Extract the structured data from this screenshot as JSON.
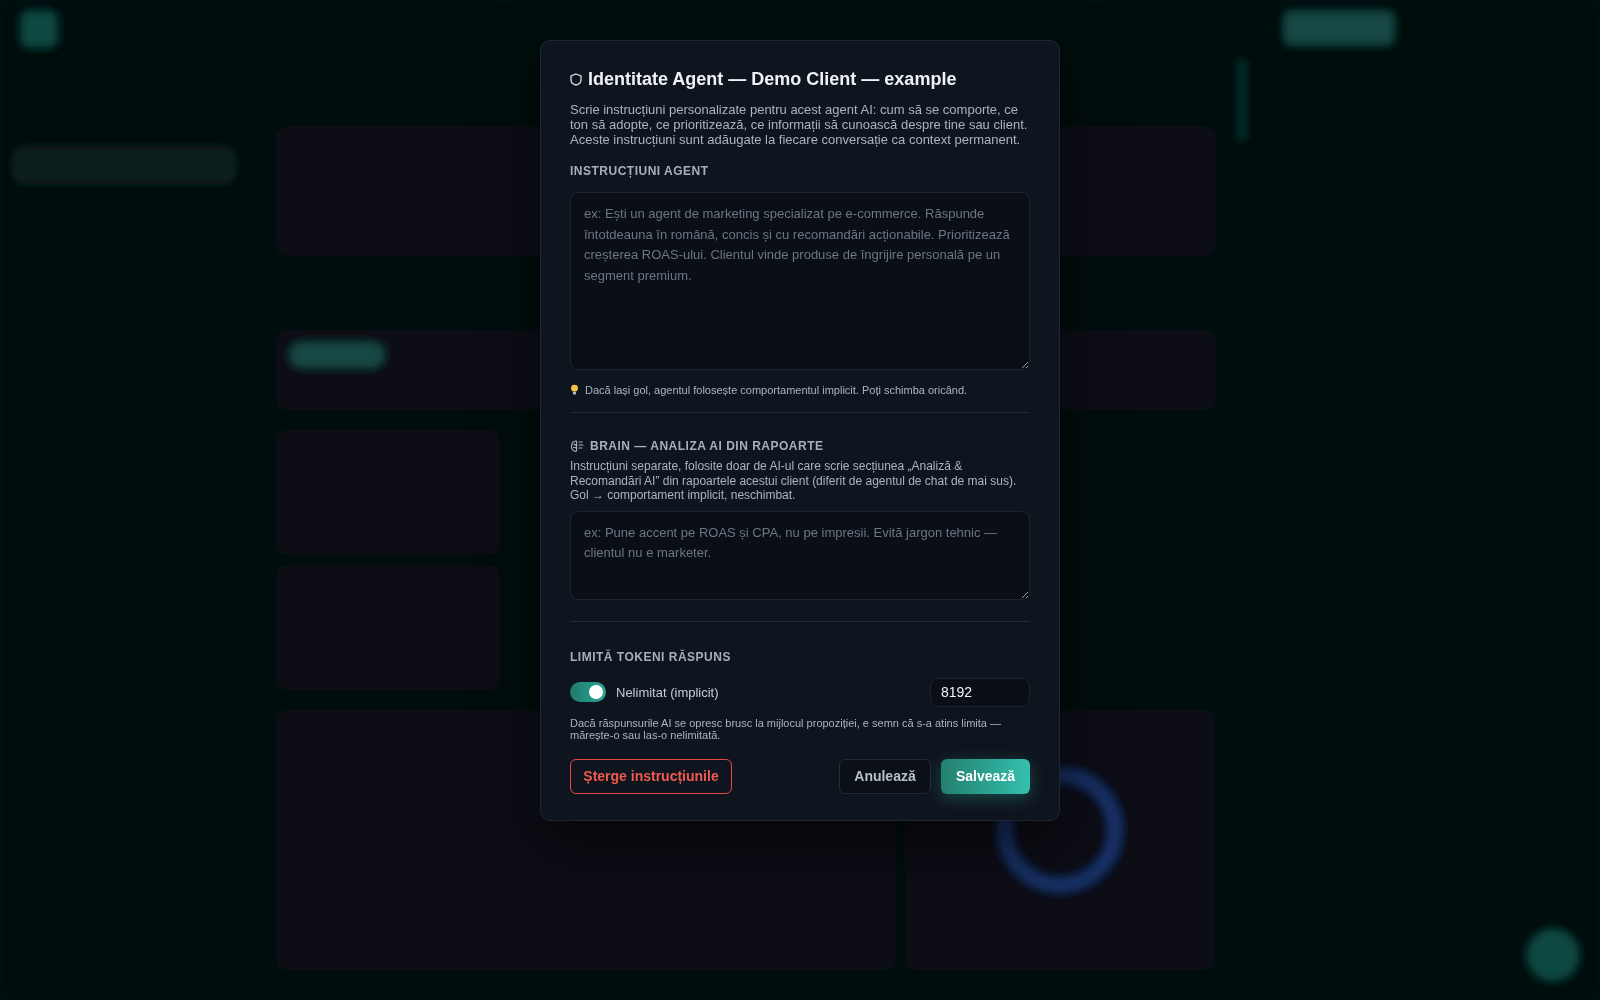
{
  "dialog": {
    "title": "Identitate Agent — Demo Client — example",
    "description": "Scrie instrucțiuni personalizate pentru acest agent AI: cum să se comporte, ce ton să adopte, ce prioritizează, ce informații să cunoască despre tine sau client. Aceste instrucțiuni sunt adăugate la fiecare conversație ca context permanent.",
    "agent_section": {
      "label": "INSTRUCȚIUNI AGENT",
      "placeholder": "ex: Ești un agent de marketing specializat pe e-commerce. Răspunde întotdeauna în română, concis și cu recomandări acționabile. Prioritizează creșterea ROAS-ului. Clientul vinde produse de îngrijire personală pe un segment premium.",
      "hint": "Dacă lași gol, agentul folosește comportamentul implicit. Poți schimba oricând."
    },
    "brain_section": {
      "label": "BRAIN — ANALIZA AI DIN RAPOARTE",
      "description": "Instrucțiuni separate, folosite doar de AI-ul care scrie secțiunea „Analiză & Recomandări AI” din rapoartele acestui client (diferit de agentul de chat de mai sus). Gol → comportament implicit, neschimbat.",
      "placeholder": "ex: Pune accent pe ROAS și CPA, nu pe impresii. Evită jargon tehnic — clientul nu e marketer."
    },
    "token_limit": {
      "label": "LIMITĂ TOKENI RĂSPUNS",
      "toggle": {
        "label": "Nelimitat (implicit)",
        "on": true
      },
      "value": "8192",
      "note": "Dacă răspunsurile AI se opresc brusc la mijlocul propoziției, e semn că s-a atins limita — mărește-o sau las-o nelimitată."
    },
    "buttons": [
      {
        "label": "Șterge instrucțiunile",
        "kind": "danger"
      },
      {
        "label": "Anulează",
        "kind": "secondary"
      },
      {
        "label": "Salvează",
        "kind": "primary"
      }
    ]
  }
}
